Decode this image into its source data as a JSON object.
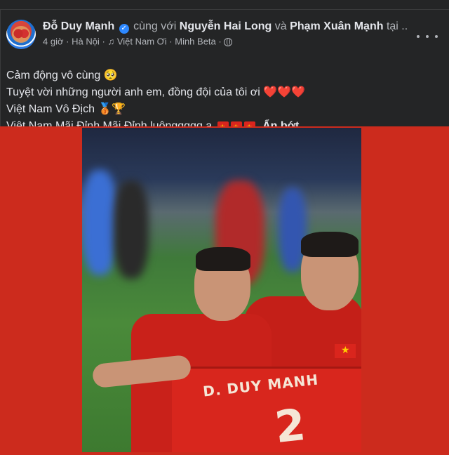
{
  "post": {
    "author": "Đỗ Duy Mạnh",
    "with_text": "cùng với",
    "tagged_1": "Nguyễn Hai Long",
    "and_text": "và",
    "tagged_2": "Phạm Xuân Mạnh",
    "truncated_tail": "tại ...",
    "time": "4 giờ",
    "location": "Hà Nội",
    "music": "Việt Nam Ơi · Minh Beta",
    "privacy_icon": "globe-icon",
    "more_icon": "more-options-icon"
  },
  "caption": {
    "line1": "Cảm động vô cùng",
    "line1_emoji": "🥺",
    "line2": "Tuyệt vời những người anh em, đồng đội của tôi ơi",
    "line2_emoji": "❤️❤️❤️",
    "line3": "Việt Nam Vô Địch",
    "line3_emoji": "🥉🏆",
    "line4": "Việt Nam Mãi Đỉnh Mãi Đỉnh luônggggg ạ",
    "see_less": "Ẩn bớt"
  },
  "photo": {
    "jersey_name": "D. DUY MANH",
    "jersey_number": "2"
  },
  "colors": {
    "background": "#242526",
    "photo_frame": "#cc2b1d",
    "verified": "#2d88ff"
  }
}
